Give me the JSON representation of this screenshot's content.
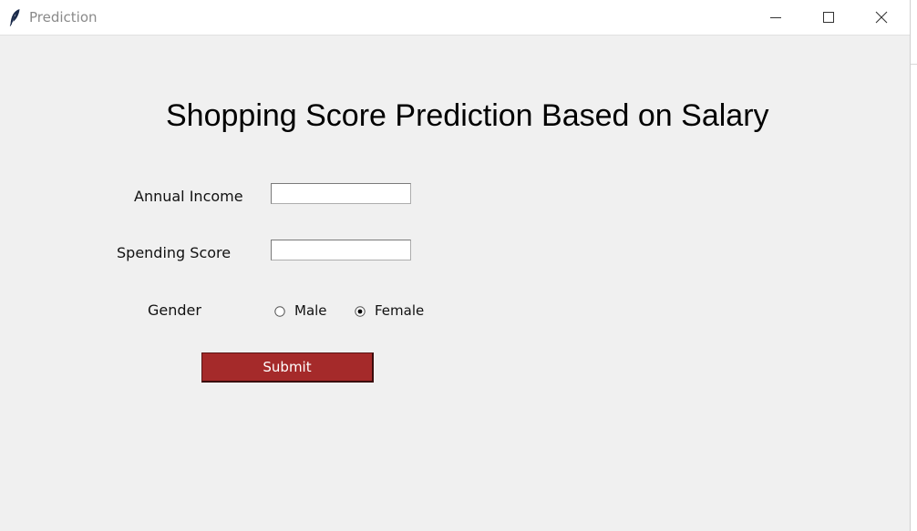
{
  "window": {
    "title": "Prediction",
    "controls": {
      "minimize_icon": "minimize-icon",
      "maximize_icon": "maximize-icon",
      "close_icon": "close-icon"
    }
  },
  "form": {
    "heading": "Shopping Score Prediction Based on Salary",
    "annual_income": {
      "label": "Annual Income",
      "value": ""
    },
    "spending_score": {
      "label": "Spending Score",
      "value": ""
    },
    "gender": {
      "label": "Gender",
      "options": [
        "Male",
        "Female"
      ],
      "selected": "Female"
    },
    "submit_label": "Submit"
  },
  "colors": {
    "submit_background": "#a52a2a",
    "submit_text": "#ffffff",
    "window_background": "#f0f0f0"
  }
}
